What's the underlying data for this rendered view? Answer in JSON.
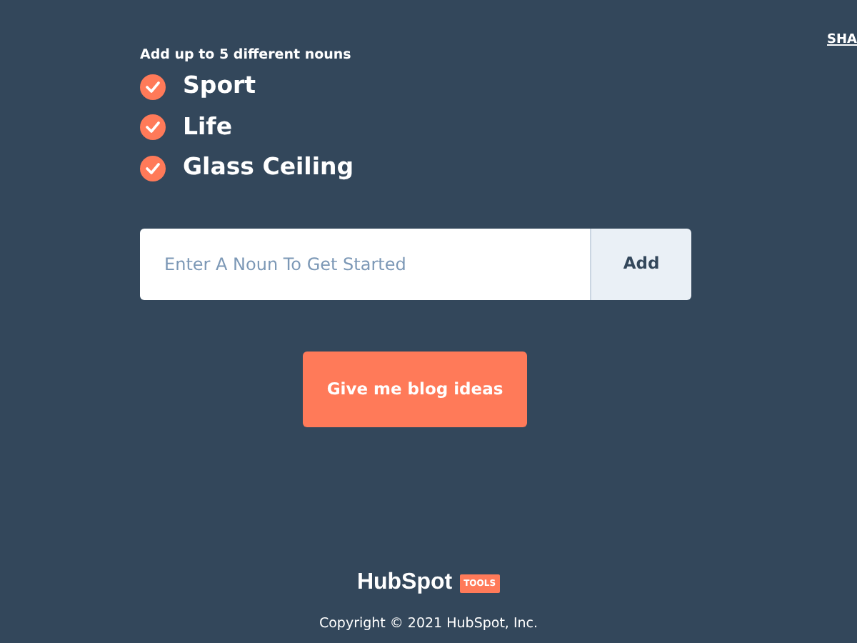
{
  "top_link": "SHA",
  "nouns": {
    "hint": "Add up to 5 different nouns",
    "items": [
      {
        "label": "Sport",
        "checked": true
      },
      {
        "label": "Life",
        "checked": true
      },
      {
        "label": "Glass Ceiling",
        "checked": true
      }
    ]
  },
  "noun_input": {
    "placeholder": "Enter A Noun To Get Started",
    "button": "Add"
  },
  "submit_button": "Give me blog ideas",
  "footer": {
    "logo": "HubSpot",
    "logo_tag": "TOOLS",
    "copyright": "Copyright © 2021 HubSpot, Inc."
  }
}
